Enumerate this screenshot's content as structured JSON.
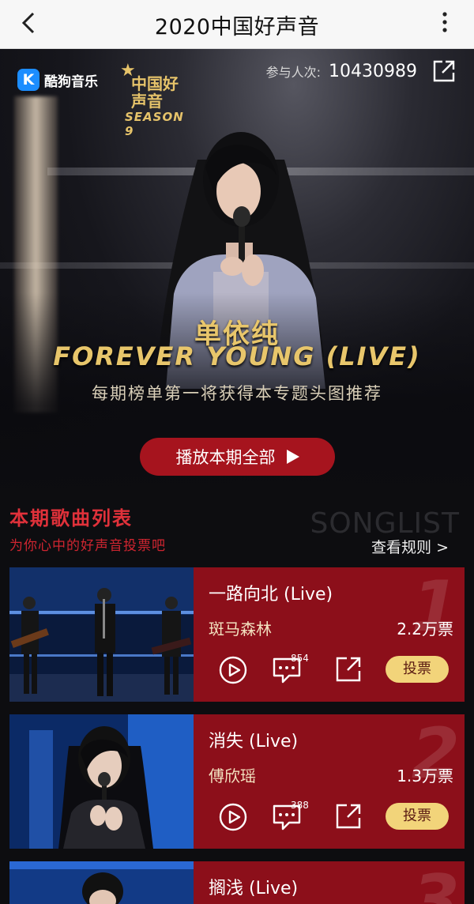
{
  "topbar": {
    "title": "2020中国好声音",
    "back_icon": "chevron-left-icon",
    "more_icon": "more-vertical-icon"
  },
  "hero": {
    "app_logo_letter": "K",
    "app_name": "酷狗音乐",
    "show_logo": {
      "cn": "中国好声音",
      "season": "SEASON 9"
    },
    "participants_label": "参与人次:",
    "participants_count": "10430989",
    "featured_artist": "单依纯",
    "featured_song": "FOREVER YOUNG (LIVE)",
    "note": "每期榜单第一将获得本专题头图推荐",
    "play_all_label": "播放本期全部"
  },
  "songlist": {
    "title": "本期歌曲列表",
    "subtitle": "为你心中的好声音投票吧",
    "bg_word": "SONGLIST",
    "rules_label": "查看规则 >",
    "items": [
      {
        "rank": "1",
        "title": "一路向北 (Live)",
        "artist": "斑马森林",
        "votes": "2.2万票",
        "comments": "854",
        "vote_label": "投票"
      },
      {
        "rank": "2",
        "title": "消失 (Live)",
        "artist": "傅欣瑶",
        "votes": "1.3万票",
        "comments": "388",
        "vote_label": "投票"
      },
      {
        "rank": "3",
        "title": "搁浅 (Live)"
      }
    ]
  },
  "colors": {
    "accent_red": "#a6141e",
    "card_red": "#8c0f1a",
    "gold": "#e8c66b",
    "vote_yellow": "#f2d47a"
  }
}
